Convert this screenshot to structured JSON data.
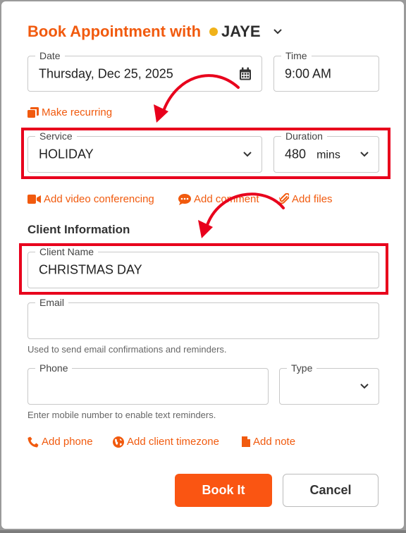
{
  "dialog": {
    "title": "Book Appointment with",
    "staff_name": "JAYE",
    "status_color": "#f0b21a"
  },
  "date": {
    "label": "Date",
    "value": "Thursday, Dec 25, 2025"
  },
  "time": {
    "label": "Time",
    "value": "9:00 AM"
  },
  "make_recurring": "Make recurring",
  "service": {
    "label": "Service",
    "value": "HOLIDAY"
  },
  "duration": {
    "label": "Duration",
    "value": "480",
    "unit": "mins"
  },
  "actions": {
    "video": "Add video conferencing",
    "comment": "Add comment",
    "files": "Add files"
  },
  "client_section": "Client Information",
  "client_name": {
    "label": "Client Name",
    "value": "CHRISTMAS DAY"
  },
  "email": {
    "label": "Email",
    "value": "",
    "hint": "Used to send email confirmations and reminders."
  },
  "phone": {
    "label": "Phone",
    "value": "",
    "hint": "Enter mobile number to enable text reminders."
  },
  "type": {
    "label": "Type",
    "value": ""
  },
  "extra_links": {
    "phone": "Add phone",
    "timezone": "Add client timezone",
    "note": "Add note"
  },
  "buttons": {
    "book": "Book It",
    "cancel": "Cancel"
  },
  "colors": {
    "accent": "#f15a0e",
    "primary_button": "#fa5512",
    "annotation_red": "#e8001c"
  }
}
